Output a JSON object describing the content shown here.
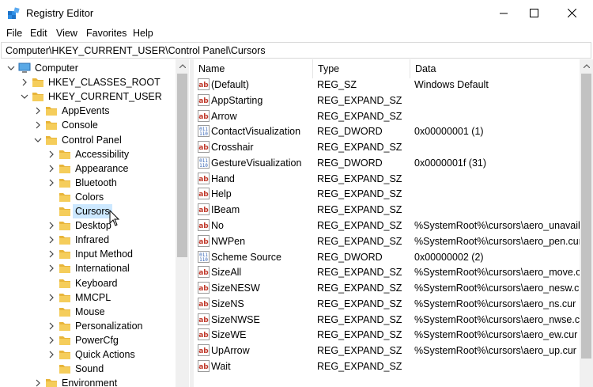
{
  "window": {
    "title": "Registry Editor",
    "icon": "registry-editor-icon"
  },
  "menu": [
    "File",
    "Edit",
    "View",
    "Favorites",
    "Help"
  ],
  "address": "Computer\\HKEY_CURRENT_USER\\Control Panel\\Cursors",
  "tree": [
    {
      "label": "Computer",
      "icon": "computer-icon",
      "expanded": true
    },
    {
      "label": "HKEY_CLASSES_ROOT",
      "icon": "folder-icon",
      "expanded": false
    },
    {
      "label": "HKEY_CURRENT_USER",
      "icon": "folder-icon",
      "expanded": true
    },
    {
      "label": "AppEvents",
      "icon": "folder-icon",
      "expanded": false
    },
    {
      "label": "Console",
      "icon": "folder-icon",
      "expanded": false
    },
    {
      "label": "Control Panel",
      "icon": "folder-icon",
      "expanded": true
    },
    {
      "label": "Accessibility",
      "icon": "folder-icon",
      "expanded": false
    },
    {
      "label": "Appearance",
      "icon": "folder-icon",
      "expanded": false
    },
    {
      "label": "Bluetooth",
      "icon": "folder-icon",
      "expanded": false
    },
    {
      "label": "Colors",
      "icon": "folder-icon",
      "expanded": null
    },
    {
      "label": "Cursors",
      "icon": "folder-icon",
      "expanded": null,
      "selected": true
    },
    {
      "label": "Desktop",
      "icon": "folder-icon",
      "expanded": false
    },
    {
      "label": "Infrared",
      "icon": "folder-icon",
      "expanded": false
    },
    {
      "label": "Input Method",
      "icon": "folder-icon",
      "expanded": false
    },
    {
      "label": "International",
      "icon": "folder-icon",
      "expanded": false
    },
    {
      "label": "Keyboard",
      "icon": "folder-icon",
      "expanded": null
    },
    {
      "label": "MMCPL",
      "icon": "folder-icon",
      "expanded": false
    },
    {
      "label": "Mouse",
      "icon": "folder-icon",
      "expanded": null
    },
    {
      "label": "Personalization",
      "icon": "folder-icon",
      "expanded": false
    },
    {
      "label": "PowerCfg",
      "icon": "folder-icon",
      "expanded": false
    },
    {
      "label": "Quick Actions",
      "icon": "folder-icon",
      "expanded": false
    },
    {
      "label": "Sound",
      "icon": "folder-icon",
      "expanded": null
    },
    {
      "label": "Environment",
      "icon": "folder-icon",
      "expanded": false
    }
  ],
  "columns": {
    "name": "Name",
    "type": "Type",
    "data": "Data"
  },
  "values": [
    {
      "name": "(Default)",
      "type": "REG_SZ",
      "data": "Windows Default",
      "icon": "string-value-icon"
    },
    {
      "name": "AppStarting",
      "type": "REG_EXPAND_SZ",
      "data": "",
      "icon": "string-value-icon"
    },
    {
      "name": "Arrow",
      "type": "REG_EXPAND_SZ",
      "data": "",
      "icon": "string-value-icon"
    },
    {
      "name": "ContactVisualization",
      "type": "REG_DWORD",
      "data": "0x00000001 (1)",
      "icon": "binary-value-icon"
    },
    {
      "name": "Crosshair",
      "type": "REG_EXPAND_SZ",
      "data": "",
      "icon": "string-value-icon"
    },
    {
      "name": "GestureVisualization",
      "type": "REG_DWORD",
      "data": "0x0000001f (31)",
      "icon": "binary-value-icon"
    },
    {
      "name": "Hand",
      "type": "REG_EXPAND_SZ",
      "data": "",
      "icon": "string-value-icon"
    },
    {
      "name": "Help",
      "type": "REG_EXPAND_SZ",
      "data": "",
      "icon": "string-value-icon"
    },
    {
      "name": "IBeam",
      "type": "REG_EXPAND_SZ",
      "data": "",
      "icon": "string-value-icon"
    },
    {
      "name": "No",
      "type": "REG_EXPAND_SZ",
      "data": "%SystemRoot%\\cursors\\aero_unavail.cur",
      "icon": "string-value-icon"
    },
    {
      "name": "NWPen",
      "type": "REG_EXPAND_SZ",
      "data": "%SystemRoot%\\cursors\\aero_pen.cur",
      "icon": "string-value-icon"
    },
    {
      "name": "Scheme Source",
      "type": "REG_DWORD",
      "data": "0x00000002 (2)",
      "icon": "binary-value-icon"
    },
    {
      "name": "SizeAll",
      "type": "REG_EXPAND_SZ",
      "data": "%SystemRoot%\\cursors\\aero_move.cur",
      "icon": "string-value-icon"
    },
    {
      "name": "SizeNESW",
      "type": "REG_EXPAND_SZ",
      "data": "%SystemRoot%\\cursors\\aero_nesw.cur",
      "icon": "string-value-icon"
    },
    {
      "name": "SizeNS",
      "type": "REG_EXPAND_SZ",
      "data": "%SystemRoot%\\cursors\\aero_ns.cur",
      "icon": "string-value-icon"
    },
    {
      "name": "SizeNWSE",
      "type": "REG_EXPAND_SZ",
      "data": "%SystemRoot%\\cursors\\aero_nwse.cur",
      "icon": "string-value-icon"
    },
    {
      "name": "SizeWE",
      "type": "REG_EXPAND_SZ",
      "data": "%SystemRoot%\\cursors\\aero_ew.cur",
      "icon": "string-value-icon"
    },
    {
      "name": "UpArrow",
      "type": "REG_EXPAND_SZ",
      "data": "%SystemRoot%\\cursors\\aero_up.cur",
      "icon": "string-value-icon"
    },
    {
      "name": "Wait",
      "type": "REG_EXPAND_SZ",
      "data": "",
      "icon": "string-value-icon"
    }
  ],
  "colors": {
    "selection": "#cce8ff",
    "folder": "#e8b53a",
    "string_icon": "#c0392b",
    "binary_icon": "#2f5fb3"
  }
}
